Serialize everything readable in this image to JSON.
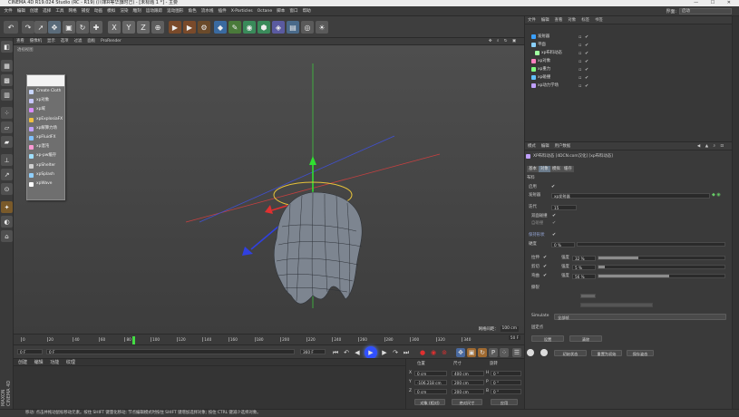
{
  "titlebar": {
    "title": "CINEMA 4D R19.024 Studio (RC - R19) (川率R等华旗时己) - [未标题 1 *] - 主要"
  },
  "menubar": {
    "items": [
      "文件",
      "编辑",
      "创建",
      "选择",
      "工具",
      "网格",
      "捕捉",
      "动画",
      "模拟",
      "渲染",
      "雕刻",
      "运动跟踪",
      "运动图形",
      "角色",
      "流水线",
      "插件",
      "X-Particles",
      "Octane",
      "脚本",
      "窗口",
      "帮助"
    ],
    "layout_label": "界面:",
    "layout_value": "启动"
  },
  "toolbar": {
    "axis_labels": [
      "X",
      "Y",
      "Z"
    ]
  },
  "viewport": {
    "menu": [
      "查看",
      "摄像机",
      "显示",
      "选项",
      "过滤",
      "面板",
      "ProRender"
    ],
    "label": "透视视图",
    "grid_label": "网格间距：",
    "grid_value": "100 cm"
  },
  "popup": {
    "items": [
      "Create Cloth",
      "xp对象",
      "xp域",
      "xpExplosiaFX",
      "xp解算力场",
      "xpFluidFX",
      "xp混沌",
      "xp-pw缓存",
      "xpShelter",
      "xpSplash",
      "xpWave"
    ],
    "icon_colors": [
      "#c9d6ff",
      "#c7c7ff",
      "#d98bff",
      "#f0c040",
      "#c0a0ff",
      "#80c0ff",
      "#ff9ad5",
      "#a0e0ff",
      "#d0d0d0",
      "#90d0ff",
      "#ffffff"
    ]
  },
  "timeline": {
    "ticks": [
      "0",
      "20",
      "40",
      "60",
      "80",
      "100",
      "120",
      "140",
      "160",
      "180",
      "200",
      "220",
      "240",
      "260",
      "280",
      "300",
      "320",
      "340"
    ],
    "end_frame": "50 F"
  },
  "transport": {
    "start": "0 F",
    "current": "0 F",
    "end": "360 F",
    "end2": "360 F"
  },
  "material_manager": {
    "menu": [
      "创建",
      "编辑",
      "功能",
      "纹理"
    ]
  },
  "coord_manager": {
    "headers": [
      "位置",
      "尺寸",
      "旋转"
    ],
    "rows": [
      {
        "axis": "X",
        "pos": "0 cm",
        "size": "400 cm",
        "rot_axis": "H",
        "rot": "0 °"
      },
      {
        "axis": "Y",
        "pos": "-106.218 cm",
        "size": "200 cm",
        "rot_axis": "P",
        "rot": "0 °"
      },
      {
        "axis": "Z",
        "pos": "0 cm",
        "size": "200 cm",
        "rot_axis": "B",
        "rot": "0 °"
      }
    ],
    "mode": "对象 (相对)",
    "size_mode": "绝对尺寸",
    "apply": "应用"
  },
  "object_manager": {
    "menu": [
      "文件",
      "编辑",
      "查看",
      "对象",
      "标签",
      "书签"
    ],
    "rows": [
      {
        "name": "发射器",
        "color": "#3aa0ff",
        "indent": 0
      },
      {
        "name": "平面",
        "color": "#8ad0ff",
        "indent": 0
      },
      {
        "name": "xp布料动态",
        "color": "#a0ffa0",
        "indent": 1
      },
      {
        "name": "xp对象",
        "color": "#ff80c0",
        "indent": 0
      },
      {
        "name": "xp重力",
        "color": "#80ff80",
        "indent": 0
      },
      {
        "name": "xp碰撞",
        "color": "#60c0ff",
        "indent": 0
      },
      {
        "name": "xp动力学场",
        "color": "#c0a0ff",
        "indent": 0
      }
    ]
  },
  "attr_manager": {
    "menu": [
      "模式",
      "编辑",
      "用户数据"
    ],
    "object_title": "XP布料动态 [4DCN.com汉化] [xp布料动态]",
    "tabs": [
      "基本",
      "对象",
      "模拟",
      "缓存"
    ],
    "section": "布料",
    "rows": {
      "enabled": "启用",
      "emitter_label": "发射器",
      "emitter_value": "xp发射器",
      "iterations_label": "迭代",
      "iterations_value": "15",
      "two_sided": "双面碰撞",
      "self_collision": "自碰撞",
      "keep_shape": "保持形状",
      "rigidity_label": "硬度",
      "rigidity_value": "0 %",
      "stretch_label": "拉伸",
      "stretch_mode": "强度",
      "stretch_value": "32 %",
      "shear_label": "剪切",
      "shear_mode": "强度",
      "shear_value": "5 %",
      "bend_label": "弯曲",
      "bend_mode": "强度",
      "bend_value": "56 %",
      "tear_label": "撕裂",
      "simulate_label": "Simulate",
      "simulate_value": "全部帧",
      "fix_points": "固定点",
      "set_btn": "设置",
      "clear_btn": "清除",
      "init_btn": "初始状态",
      "reset_btn": "重置为初始",
      "save_btn": "保存姿态",
      "load_btn": "加载姿态"
    },
    "stretch_fraction": 0.32,
    "shear_fraction": 0.05,
    "bend_fraction": 0.56
  },
  "statusbar": {
    "text": "移动: 点击并拖动鼠标移动元素。按住 SHIFT 键量化移动; 节点编辑模式时按住 SHIFT 键增加选择对象; 按住 CTRL 键减少选择对象。"
  }
}
